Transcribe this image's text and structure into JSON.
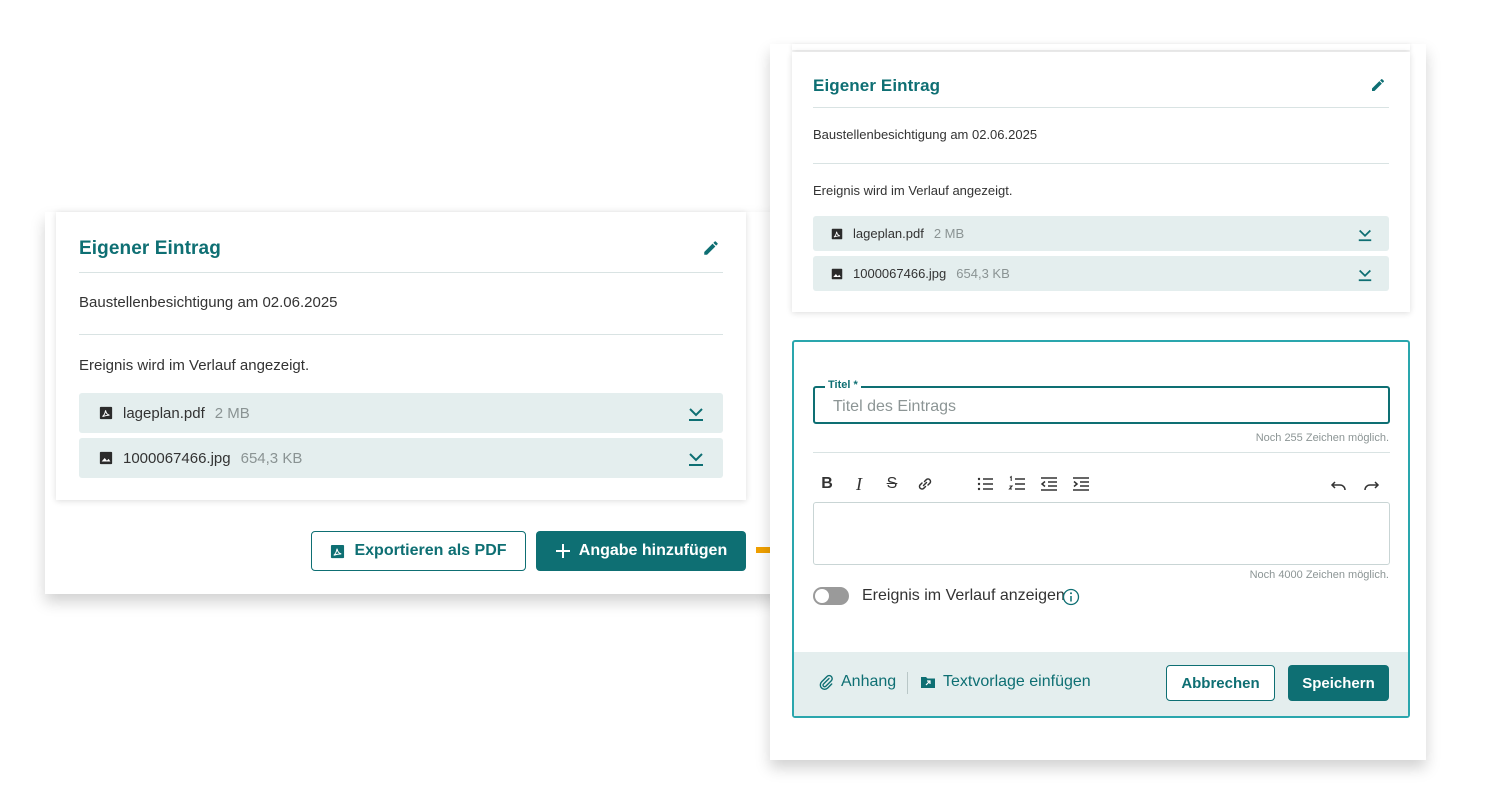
{
  "left_card": {
    "title": "Eigener Eintrag",
    "description": "Baustellenbesichtigung am 02.06.2025",
    "visibility_text": "Ereignis wird im Verlauf angezeigt.",
    "files": [
      {
        "name": "lageplan.pdf",
        "size": "2 MB",
        "icon": "pdf-icon"
      },
      {
        "name": "1000067466.jpg",
        "size": "654,3 KB",
        "icon": "image-icon"
      }
    ]
  },
  "actions": {
    "export_label": "Exportieren als PDF",
    "add_label": "Angabe hinzufügen"
  },
  "right_card": {
    "title": "Eigener Eintrag",
    "description": "Baustellenbesichtigung am 02.06.2025",
    "visibility_text": "Ereignis wird im Verlauf angezeigt.",
    "files": [
      {
        "name": "lageplan.pdf",
        "size": "2 MB",
        "icon": "pdf-icon"
      },
      {
        "name": "1000067466.jpg",
        "size": "654,3 KB",
        "icon": "image-icon"
      }
    ]
  },
  "form": {
    "title_label": "Titel",
    "required_mark": "*",
    "title_placeholder": "Titel des Eintrags",
    "title_hint": "Noch 255 Zeichen möglich.",
    "body_hint": "Noch 4000 Zeichen möglich.",
    "toggle_label": "Ereignis im Verlauf anzeigen",
    "toggle_on": false,
    "toolbar": {
      "bold": "B",
      "italic": "I",
      "strike": "S"
    },
    "footer": {
      "attach_label": "Anhang",
      "template_label": "Textvorlage einfügen",
      "cancel_label": "Abbrechen",
      "save_label": "Speichern"
    }
  },
  "colors": {
    "accent": "#0e6f73",
    "arrow": "#f0a000",
    "form_border": "#2aa6ad",
    "chip_background": "#e4eeee"
  }
}
